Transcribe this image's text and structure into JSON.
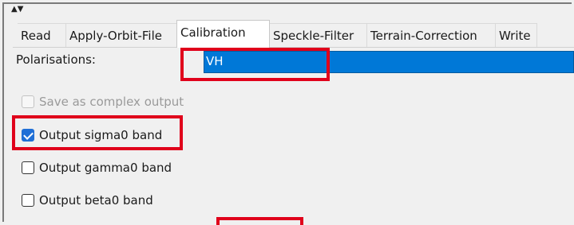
{
  "window": {
    "scroll_arrows": "▲▼"
  },
  "tabs": [
    {
      "label": "Read",
      "active": false
    },
    {
      "label": "Apply-Orbit-File",
      "active": false
    },
    {
      "label": "Calibration",
      "active": true
    },
    {
      "label": "Speckle-Filter",
      "active": false
    },
    {
      "label": "Terrain-Correction",
      "active": false
    },
    {
      "label": "Write",
      "active": false
    }
  ],
  "polarisations": {
    "label": "Polarisations:",
    "items": [
      {
        "label": "VH",
        "selected": true
      }
    ]
  },
  "options": {
    "complex": {
      "label": "Save as complex output",
      "checked": false,
      "enabled": false
    },
    "sigma0": {
      "label": "Output sigma0 band",
      "checked": true,
      "enabled": true
    },
    "gamma0": {
      "label": "Output gamma0 band",
      "checked": false,
      "enabled": true
    },
    "beta0": {
      "label": "Output beta0 band",
      "checked": false,
      "enabled": true
    }
  },
  "colors": {
    "highlight_red": "#e0001b",
    "selection_blue": "#0078d7",
    "check_blue": "#1f6fd6"
  }
}
